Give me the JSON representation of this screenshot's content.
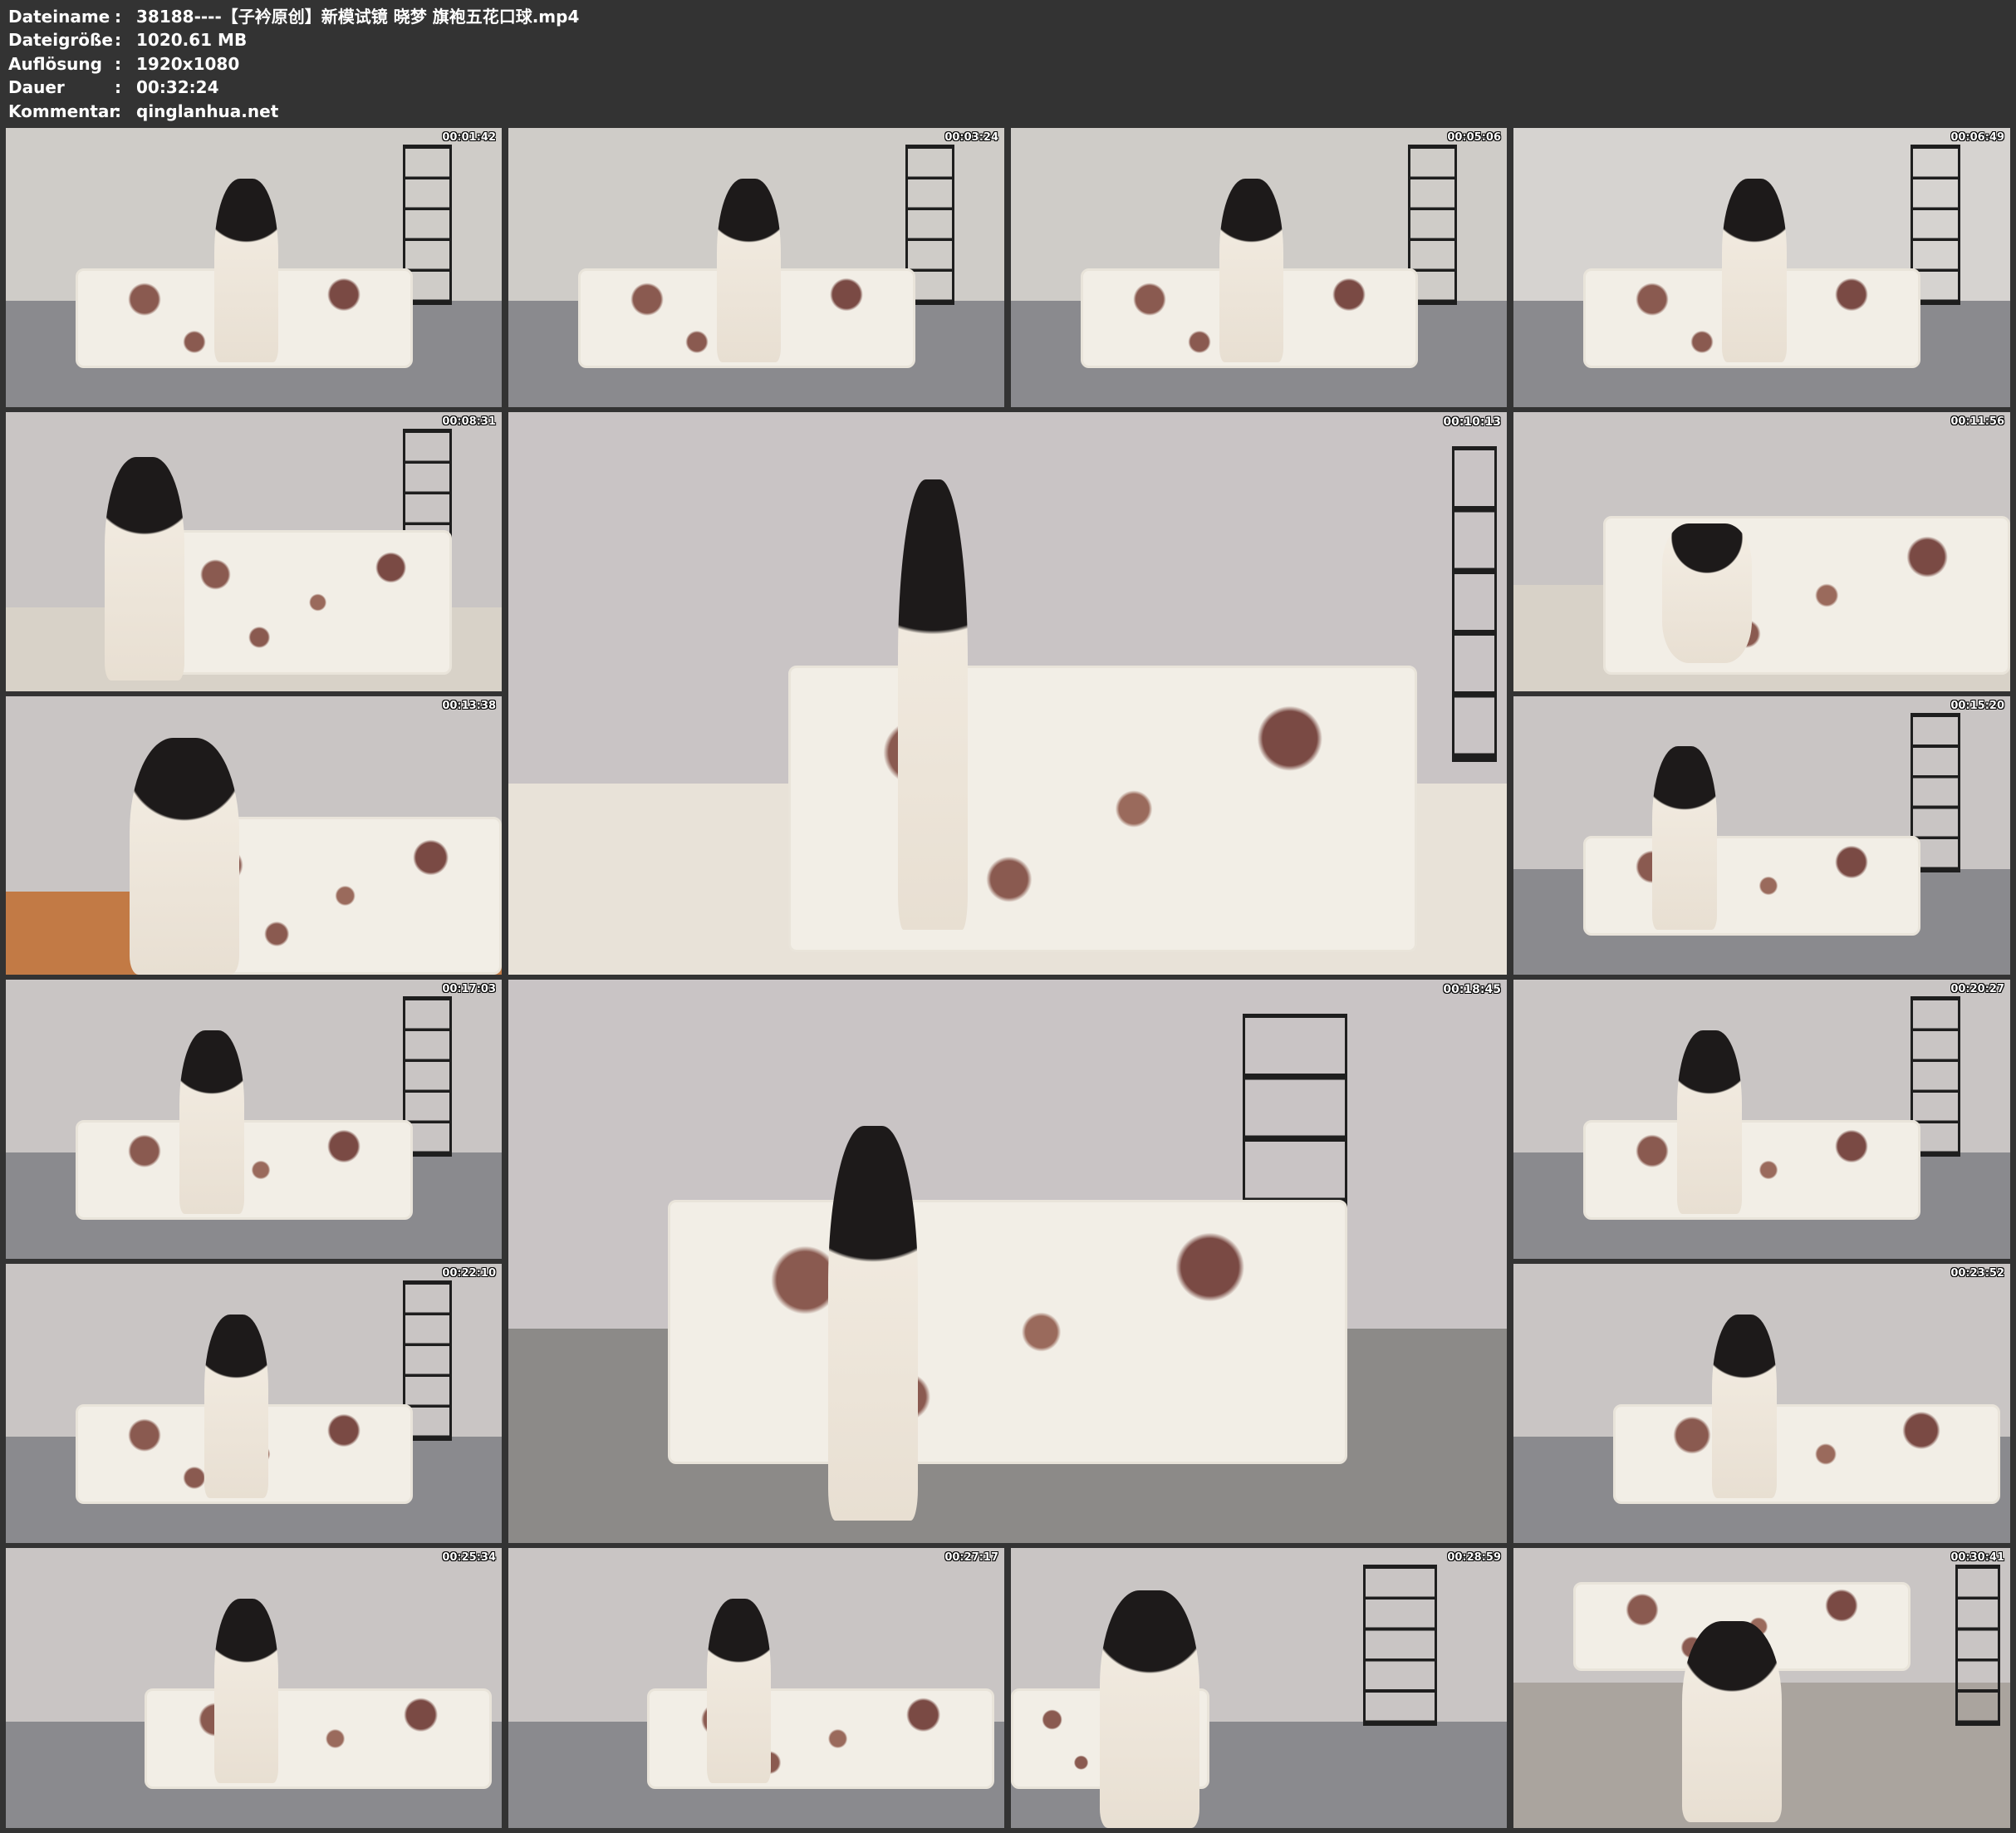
{
  "info": {
    "rows": [
      {
        "label": "Dateiname",
        "value": "38188----【子衿原创】新模试镜 晓梦 旗袍五花口球.mp4"
      },
      {
        "label": "Dateigröße",
        "value": "1020.61 MB"
      },
      {
        "label": "Auflösung",
        "value": "1920x1080"
      },
      {
        "label": "Dauer",
        "value": "00:32:24"
      },
      {
        "label": "Kommentar",
        "value": "qinglanhua.net"
      }
    ]
  },
  "thumbnails": [
    {
      "timestamp": "00:01:42"
    },
    {
      "timestamp": "00:03:24"
    },
    {
      "timestamp": "00:05:06"
    },
    {
      "timestamp": "00:06:49"
    },
    {
      "timestamp": "00:08:31"
    },
    {
      "timestamp": "00:10:13"
    },
    {
      "timestamp": "00:11:56"
    },
    {
      "timestamp": "00:13:38"
    },
    {
      "timestamp": "00:15:20"
    },
    {
      "timestamp": "00:17:03"
    },
    {
      "timestamp": "00:18:45"
    },
    {
      "timestamp": "00:20:27"
    },
    {
      "timestamp": "00:22:10"
    },
    {
      "timestamp": "00:23:52"
    },
    {
      "timestamp": "00:25:34"
    },
    {
      "timestamp": "00:27:17"
    },
    {
      "timestamp": "00:28:59"
    },
    {
      "timestamp": "00:30:41"
    }
  ],
  "colors": {
    "background": "#333333",
    "text": "#ffffff"
  }
}
